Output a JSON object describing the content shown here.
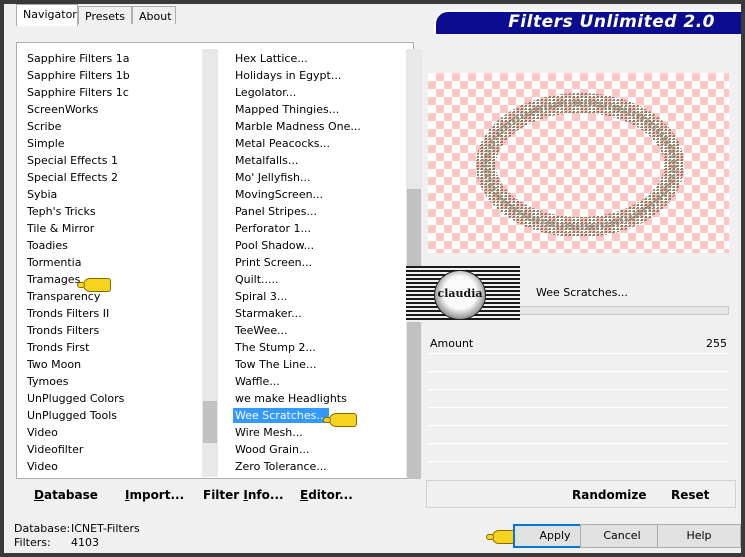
{
  "banner": {
    "title": "Filters Unlimited 2.0"
  },
  "tabs": [
    {
      "label": "Navigator",
      "active": true
    },
    {
      "label": "Presets",
      "active": false
    },
    {
      "label": "About",
      "active": false
    }
  ],
  "categories": [
    "Sapphire Filters 1a",
    "Sapphire Filters 1b",
    "Sapphire Filters 1c",
    "ScreenWorks",
    "Scribe",
    "Simple",
    "Special Effects 1",
    "Special Effects 2",
    "Sybia",
    "Teph's Tricks",
    "Tile & Mirror",
    "Toadies",
    "Tormentia",
    "Tramages",
    "Transparency",
    "Tronds Filters II",
    "Tronds Filters",
    "Tronds First",
    "Two Moon",
    "Tymoes",
    "UnPlugged Colors",
    "UnPlugged Tools",
    "Video",
    "Videofilter",
    "Video"
  ],
  "filters": [
    "Hex Lattice...",
    "Holidays in Egypt...",
    "Legolator...",
    "Mapped Thingies...",
    "Marble Madness One...",
    "Metal Peacocks...",
    "Metalfalls...",
    "Mo' Jellyfish...",
    "MovingScreen...",
    "Panel Stripes...",
    "Perforator 1...",
    "Pool Shadow...",
    "Print Screen...",
    "Quilt.....",
    "Spiral 3...",
    "Starmaker...",
    "TeeWee...",
    "The Stump 2...",
    "Tow The Line...",
    "Waffle...",
    "we make Headlights",
    "Wee Scratches...",
    "Wire Mesh...",
    "Wood Grain...",
    "Zero Tolerance..."
  ],
  "selected_filter": "Wee Scratches...",
  "left_buttons": {
    "database": {
      "label": "atabase",
      "hotkey": "D"
    },
    "import": {
      "label": "mport...",
      "hotkey": "I"
    },
    "filter_info": {
      "label": "Filter ",
      "hotkey": "I",
      "rest": "nfo..."
    },
    "editor": {
      "label": "ditor...",
      "hotkey": "E"
    }
  },
  "right_panel": {
    "filter_name": "Wee Scratches...",
    "param_label": "Amount",
    "param_value": "255",
    "randomize": "Randomize",
    "reset": "Reset"
  },
  "logo_text": "claudia",
  "footer": {
    "database_label": "Database:",
    "database_value": "ICNET-Filters",
    "filters_label": "Filters:",
    "filters_value": "4103"
  },
  "buttons": {
    "apply": "Apply",
    "cancel": "Cancel",
    "help": "Help"
  },
  "colors": {
    "banner_bg": "#0c0c90",
    "selection": "#3399ff",
    "checker": "#ffc6c6",
    "ring": "#8f8a70"
  }
}
